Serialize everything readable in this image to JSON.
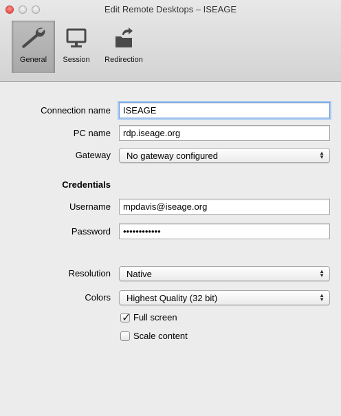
{
  "window": {
    "title": "Edit Remote Desktops – ISEAGE"
  },
  "tabs": [
    {
      "label": "General",
      "icon": "wrench-icon",
      "selected": true
    },
    {
      "label": "Session",
      "icon": "monitor-icon",
      "selected": false
    },
    {
      "label": "Redirection",
      "icon": "folder-redirect-icon",
      "selected": false
    }
  ],
  "form": {
    "connection_name": {
      "label": "Connection name",
      "value": "ISEAGE"
    },
    "pc_name": {
      "label": "PC name",
      "value": "rdp.iseage.org"
    },
    "gateway": {
      "label": "Gateway",
      "value": "No gateway configured"
    },
    "credentials_heading": "Credentials",
    "username": {
      "label": "Username",
      "value": "mpdavis@iseage.org"
    },
    "password": {
      "label": "Password",
      "value": "••••••••••••"
    },
    "resolution": {
      "label": "Resolution",
      "value": "Native"
    },
    "colors": {
      "label": "Colors",
      "value": "Highest Quality (32 bit)"
    },
    "full_screen": {
      "label": "Full screen",
      "checked": true
    },
    "scale_content": {
      "label": "Scale content",
      "checked": false
    }
  }
}
